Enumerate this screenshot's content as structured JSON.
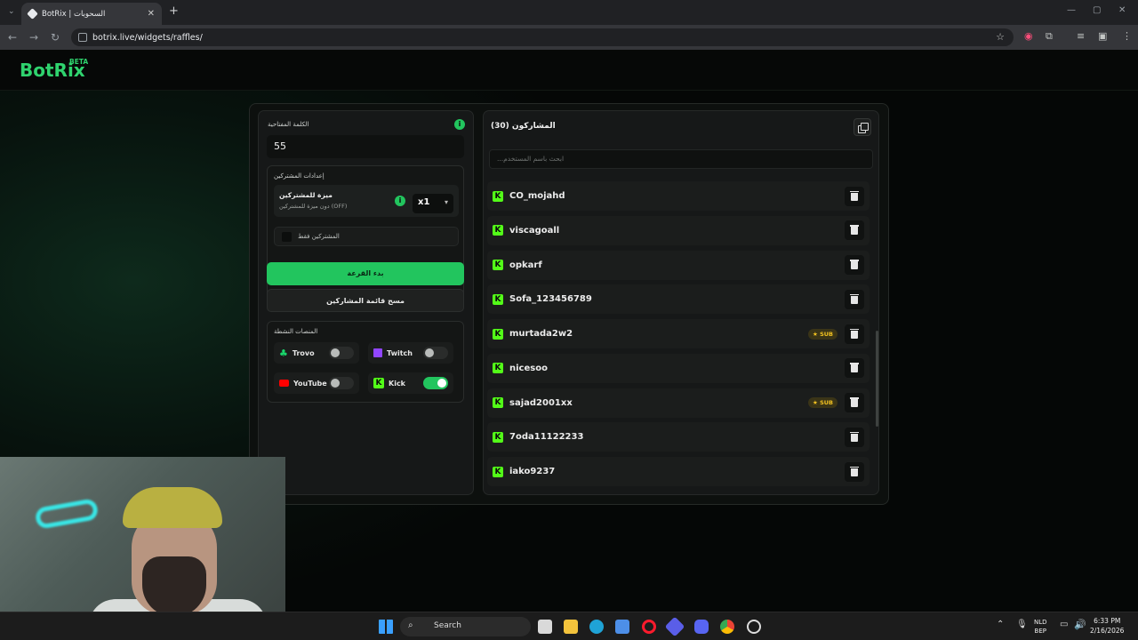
{
  "browser": {
    "tab_title": "BotRix | السحوبات",
    "url": "botrix.live/widgets/raffles/"
  },
  "app": {
    "logo": "BotRix",
    "logo_badge": "BETA"
  },
  "left_panel": {
    "keyword_label": "الكلمة المفتاحية",
    "keyword_value": "55",
    "settings_title": "إعدادات المشتركين",
    "bonus_title": "ميزة للمشتركين",
    "bonus_subtitle": "دون ميزة للمشتركين (OFF)",
    "multiplier": "x1",
    "subs_only_label": "المشتركين فقط",
    "start_button": "بدء القرعة",
    "clear_button": "مسح قائمة المشاركين",
    "platforms_title": "المنصات النشطة",
    "platforms": [
      {
        "name": "Trovo",
        "enabled": false,
        "color": "#19d66b"
      },
      {
        "name": "Twitch",
        "enabled": false,
        "color": "#9146ff"
      },
      {
        "name": "YouTube",
        "enabled": false,
        "color": "#ff0000"
      },
      {
        "name": "Kick",
        "enabled": true,
        "color": "#53fc18"
      }
    ]
  },
  "right_panel": {
    "title": "المشاركون (30)",
    "search_placeholder": "...ابحث باسم المستخدم",
    "participants": [
      {
        "name": "CO_mojahd",
        "sub": false
      },
      {
        "name": "viscagoall",
        "sub": false
      },
      {
        "name": "opkarf",
        "sub": false
      },
      {
        "name": "Sofa_123456789",
        "sub": false
      },
      {
        "name": "murtada2w2",
        "sub": true
      },
      {
        "name": "nicesoo",
        "sub": false
      },
      {
        "name": "sajad2001xx",
        "sub": true
      },
      {
        "name": "7oda11122233",
        "sub": false
      },
      {
        "name": "iako9237",
        "sub": false
      }
    ],
    "sub_badge": "★ SUB"
  },
  "taskbar": {
    "search": "Search",
    "lang_1": "NLD",
    "lang_2": "BEP",
    "time": "6:33 PM",
    "date": "2/16/2026"
  },
  "colors": {
    "accent": "#22c55e",
    "kick": "#53fc18"
  }
}
